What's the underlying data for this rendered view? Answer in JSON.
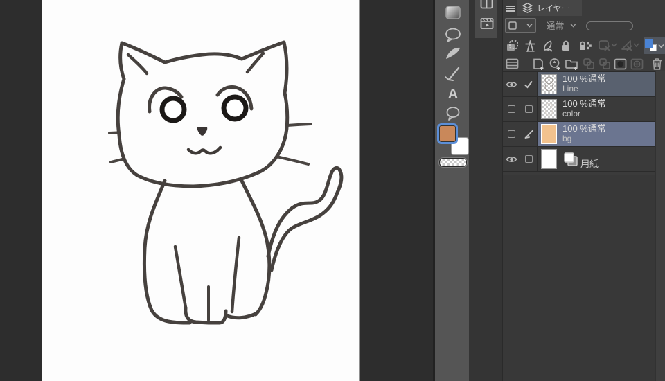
{
  "app": {
    "name": "paint-app-workspace",
    "description": "digital painting app with canvas and layers panel"
  },
  "canvas": {
    "content": "cat line drawing"
  },
  "toolbar": {
    "icons": [
      "gradient-tool-icon",
      "balloon-tool-icon",
      "figure-curve-tool-icon",
      "ruler-pen-tool-icon",
      "text-tool-icon",
      "ellipse-balloon-tool-icon",
      "transparent-color-chip"
    ],
    "text_tool_glyph": "A",
    "foreground_color": "#c9885a",
    "background_color": "#ffffff"
  },
  "mini_panel": {
    "icons": [
      "panels-icon",
      "timeline-icon"
    ]
  },
  "layers": {
    "tab_label": "レイヤー",
    "blend_mode": "通常",
    "header_icons": [
      "panel-menu-icon",
      "layers-stack-icon",
      "layer-effect-dropdown",
      "blend-mode-dropdown",
      "opacity-slider"
    ],
    "property_icons": [
      "clip-below-icon",
      "reference-layer-icon",
      "draft-layer-icon",
      "lock-layer-icon",
      "lock-alpha-icon",
      "enable-mask-icon-disabled",
      "ruler-icon-disabled",
      "layer-color-icon"
    ],
    "action_icons": [
      "layer-property-icon",
      "new-raster-layer-icon",
      "new-special-layer-icon",
      "new-folder-icon",
      "transfer-down-icon-disabled",
      "merge-down-icon-disabled",
      "create-mask-icon",
      "apply-mask-icon-disabled",
      "delete-layer-icon"
    ],
    "rows": [
      {
        "line1": "100 %通常",
        "line2": "Line"
      },
      {
        "line1": "100 %通常",
        "line2": "color"
      },
      {
        "line1": "100 %通常",
        "line2": "bg"
      },
      {
        "label": "用紙"
      }
    ]
  },
  "colors": {
    "accent_blue": "#4a83d4",
    "selection_ring_blue": "#5c8fd8",
    "foreground_swatch_orange": "#c9885a",
    "bg_layer_thumb_orange": "#f2c28e",
    "selected_row": "#59616f",
    "active_row": "#6b7590",
    "panel_bg": "#3b3b3b",
    "toolstrip_bg": "#555555",
    "workspace_bg": "#2d2d2d"
  }
}
